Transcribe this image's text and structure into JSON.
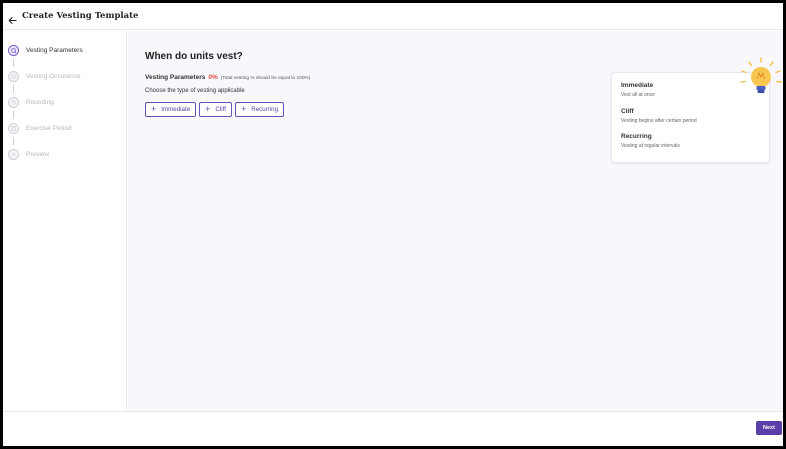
{
  "header": {
    "title": "Create Vesting Template",
    "back_icon": "arrow-left-icon"
  },
  "sidebar": {
    "steps": [
      {
        "label": "Vesting Parameters",
        "active": true
      },
      {
        "label": "Vesting Occurence",
        "active": false
      },
      {
        "label": "Rounding",
        "active": false
      },
      {
        "label": "Exercise Period",
        "active": false
      },
      {
        "label": "Preview",
        "active": false
      }
    ]
  },
  "main": {
    "heading": "When do units vest?",
    "vesting_params_label": "Vesting Parameters",
    "vesting_percent": "0%",
    "vesting_note": "(Total vesting % should be equal to 100%)",
    "choose_text": "Choose the type of vesting applicable",
    "buttons": [
      {
        "label": "Immediate"
      },
      {
        "label": "Cliff"
      },
      {
        "label": "Recurring"
      }
    ]
  },
  "info_card": {
    "items": [
      {
        "title": "Immediate",
        "desc": "Vest all at once"
      },
      {
        "title": "Cliff",
        "desc": "Vesting begins after certain period"
      },
      {
        "title": "Recurring",
        "desc": "Vesting at regular intervals"
      }
    ]
  },
  "footer": {
    "next_label": "Next"
  },
  "colors": {
    "accent": "#5b3fa8",
    "percent": "#e04b3b",
    "bulb": "#f7b733"
  }
}
